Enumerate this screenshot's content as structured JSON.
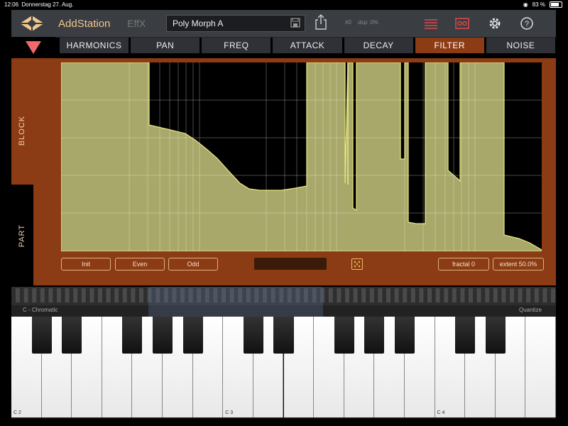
{
  "status": {
    "time": "12:06",
    "date": "Donnerstag 27. Aug.",
    "battery": "83 %"
  },
  "header": {
    "app_title": "AddStation",
    "effx": "EffX",
    "preset_name": "Poly Morph A",
    "stat_a": "#0",
    "stat_b": "dsp: 0%"
  },
  "tabs": [
    "HARMONICS",
    "PAN",
    "FREQ",
    "ATTACK",
    "DECAY",
    "FILTER",
    "NOISE"
  ],
  "active_tab": "FILTER",
  "side": {
    "block": "BLOCK",
    "part": "PART"
  },
  "buttons": {
    "init": "Init",
    "even": "Even",
    "odd": "Odd",
    "fractal": "fractal 0",
    "extent": "extent 50.0%"
  },
  "keyboard": {
    "scale": "C - Chromatic",
    "quantize": "Quantize",
    "octaves": [
      "C 2",
      "C 3",
      "C 4"
    ]
  },
  "colors": {
    "accent": "#8c3c15",
    "fill": "#a8a86a",
    "line": "#e8e880"
  }
}
